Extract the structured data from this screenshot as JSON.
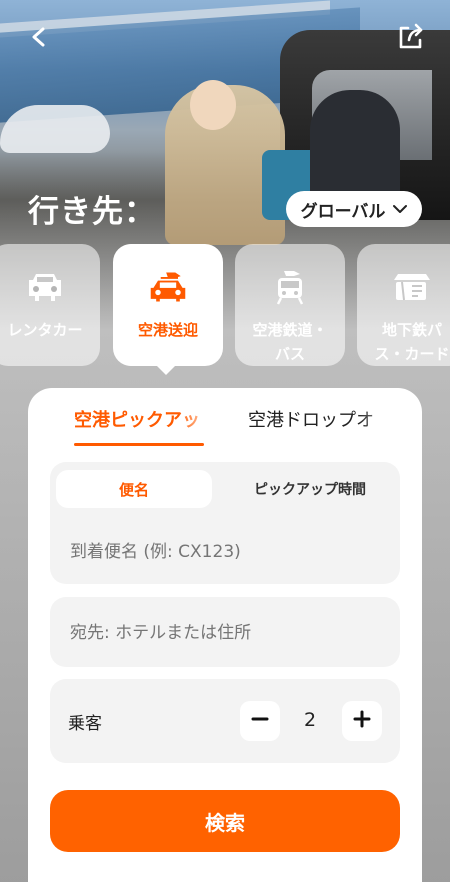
{
  "header": {
    "back_icon": "chevron-left-icon",
    "share_icon": "share-icon"
  },
  "destination": {
    "label": "行き先：",
    "region": "グローバル",
    "region_icon": "chevron-down-icon"
  },
  "categories": [
    {
      "label": "レンタカー",
      "icon": "car-icon",
      "active": false
    },
    {
      "label": "空港送迎",
      "icon": "airport-transfer-car-icon",
      "active": true
    },
    {
      "label": "空港鉄道・\nバス",
      "icon": "airport-train-bus-icon",
      "active": false
    },
    {
      "label": "地下鉄パ\nス・カード",
      "icon": "metro-pass-card-icon",
      "active": false
    }
  ],
  "tabs": [
    {
      "label": "空港ピックアッ",
      "active": true
    },
    {
      "label": "空港ドロップオ",
      "active": false
    }
  ],
  "flight_mode": {
    "by_flight": "便名",
    "by_time": "ピックアップ時間"
  },
  "flight_input": {
    "placeholder": "到着便名 (例: CX123)",
    "value": ""
  },
  "destination_input": {
    "placeholder": "宛先: ホテルまたは住所",
    "value": ""
  },
  "passengers": {
    "label": "乗客",
    "value": "2",
    "minus": "−",
    "plus": "+"
  },
  "search_button": {
    "label": "検索"
  },
  "colors": {
    "accent": "#ff5a00",
    "button": "#ff6200"
  }
}
